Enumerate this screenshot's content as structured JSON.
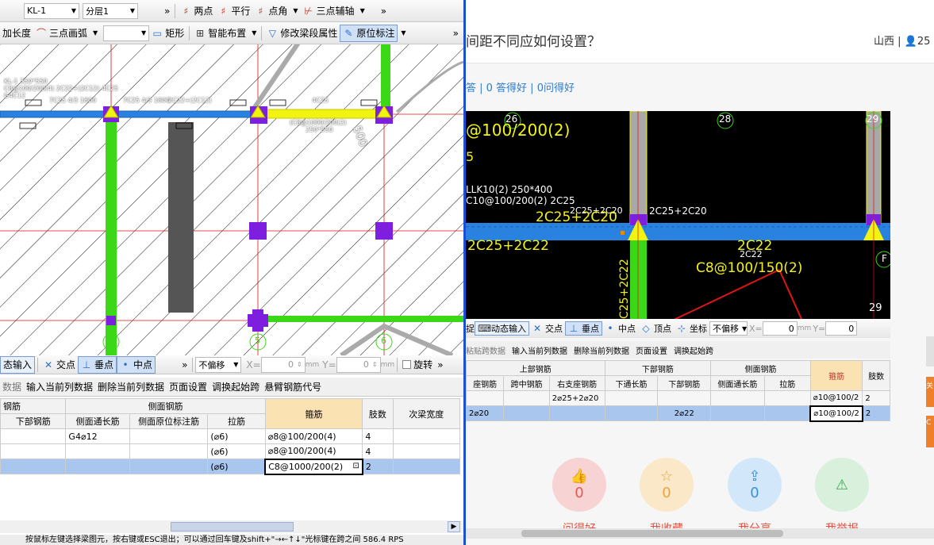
{
  "left": {
    "toolbar1": {
      "beam": "KL-1",
      "layer": "分层1",
      "more": "»",
      "two_point": "两点",
      "parallel": "平行",
      "point_angle": "点角",
      "three_point_axis": "三点辅轴",
      "more2": "»"
    },
    "toolbar2": {
      "length": "加长度",
      "arc": "三点画弧",
      "rect": "矩形",
      "smart_layout": "智能布置",
      "modify_props": "修改梁段属性",
      "in_situ": "原位标注",
      "more": "»"
    },
    "cad_labels": {
      "kl_line1": "KL-1 350*550",
      "kl_line2": "C8@100/200(4) 2C22+(2C12) 4C25",
      "kl_line3": "G4C12",
      "l_line": "7C25 4/3 1800",
      "m_line": "7C25 4/3 1800",
      "n_line": "2C22+(2C12)",
      "r_line": "4C25",
      "stirrup_line1": "(C8@1000/200(2)",
      "stirrup_line2": "250*550",
      "len500": "500",
      "axis4": "4",
      "axis5": "5",
      "axis6": "6"
    },
    "snapbar": {
      "dynamic_input": "态输入",
      "intersection": "交点",
      "perp": "垂点",
      "midpoint": "中点",
      "more": "»",
      "offset": "不偏移",
      "x_label": "X=",
      "x_value": "0",
      "x_unit": "mm",
      "y_label": "Y=",
      "y_value": "0",
      "y_unit": "mm",
      "rotate": "旋转",
      "more2": "»"
    },
    "actionbar": [
      "数据",
      "输入当前列数据",
      "删除当前列数据",
      "页面设置",
      "调换起始跨",
      "悬臂钢筋代号"
    ],
    "table": {
      "group_headers": {
        "rebar": "钢筋",
        "side": "侧面钢筋"
      },
      "headers": [
        "下部钢筋",
        "侧面通长筋",
        "侧面原位标注筋",
        "拉筋",
        "箍筋",
        "肢数",
        "次梁宽度"
      ],
      "rows": [
        [
          "",
          "G4⌀12",
          "",
          "(⌀6)",
          "⌀8@100/200(4)",
          "4",
          ""
        ],
        [
          "",
          "",
          "",
          "(⌀6)",
          "⌀8@100/200(4)",
          "4",
          ""
        ],
        [
          "",
          "",
          "",
          "(⌀6)",
          "C8@1000/200(2)",
          "2",
          ""
        ]
      ]
    },
    "statusbar": "按鼠标左键选择梁图元，按右键或ESC退出；可以通过回车键及shift+\"→←↑↓\"光标键在跨之间 586.4 RPS"
  },
  "right": {
    "title": "间距不同应如何设置？",
    "location": "山西",
    "user_count": "25",
    "stats": "答 | 0 答得好 | 0问得好",
    "cad2": {
      "top_text": "@100/200(2)",
      "five": "5",
      "llk_line1": "LLK10(2) 250*400",
      "llk_line2": "C10@100/200(2) 2C25",
      "lbl_a": "2C25+2C20",
      "lbl_b": "2C25+2C20",
      "lbl_c": "2C25+2C20",
      "bottom_left": "2C25+2C22",
      "c22_big": "2C22",
      "c22_small": "2C22",
      "c8": "C8@100/150(2)",
      "vertical": "C25+2C22",
      "n26": "26",
      "n28": "28",
      "n29a": "29",
      "n29b": "29",
      "F": "F"
    },
    "snapbar": {
      "p1": "捉",
      "dynamic_input": "动态输入",
      "intersection": "交点",
      "perp": "垂点",
      "midpoint": "中点",
      "vertex": "顶点",
      "coord": "坐标",
      "offset": "不偏移",
      "x_label": "X=",
      "x_value": "0",
      "x_unit": "mm",
      "y_label": "Y=",
      "y_value": "0"
    },
    "actionbar": [
      "粘贴跨数据",
      "输入当前列数据",
      "删除当前列数据",
      "页面设置",
      "调换起始跨"
    ],
    "table": {
      "group_headers": {
        "top": "上部钢筋",
        "bottom": "下部钢筋",
        "side": "侧面钢筋"
      },
      "headers": [
        "座钢筋",
        "跨中钢筋",
        "右支座钢筋",
        "下通长筋",
        "下部钢筋",
        "侧面通长筋",
        "拉筋",
        "箍筋",
        "肢数"
      ],
      "rows": [
        [
          "",
          "",
          "2⌀25+2⌀20",
          "",
          "",
          "",
          "",
          "⌀10@100/2",
          "2"
        ],
        [
          "2⌀20",
          "",
          "",
          "",
          "2⌀22",
          "",
          "",
          "⌀10@100/2",
          "2"
        ]
      ]
    },
    "actions": [
      {
        "icon": "thumbs-up-icon",
        "count": "0",
        "label": "问得好",
        "color": "#f8d3d3",
        "fg": "#e05a5a"
      },
      {
        "icon": "star-icon",
        "count": "0",
        "label": "我收藏",
        "color": "#fbe8c8",
        "fg": "#e8a53b"
      },
      {
        "icon": "share-icon",
        "count": "0",
        "label": "我分享",
        "color": "#d2e8fa",
        "fg": "#3a90d8"
      },
      {
        "icon": "alert-icon",
        "count": "",
        "label": "我举报",
        "color": "#d8f0dc",
        "fg": "#3aa852"
      }
    ],
    "side_tab1": "关",
    "side_tab2": "C"
  }
}
